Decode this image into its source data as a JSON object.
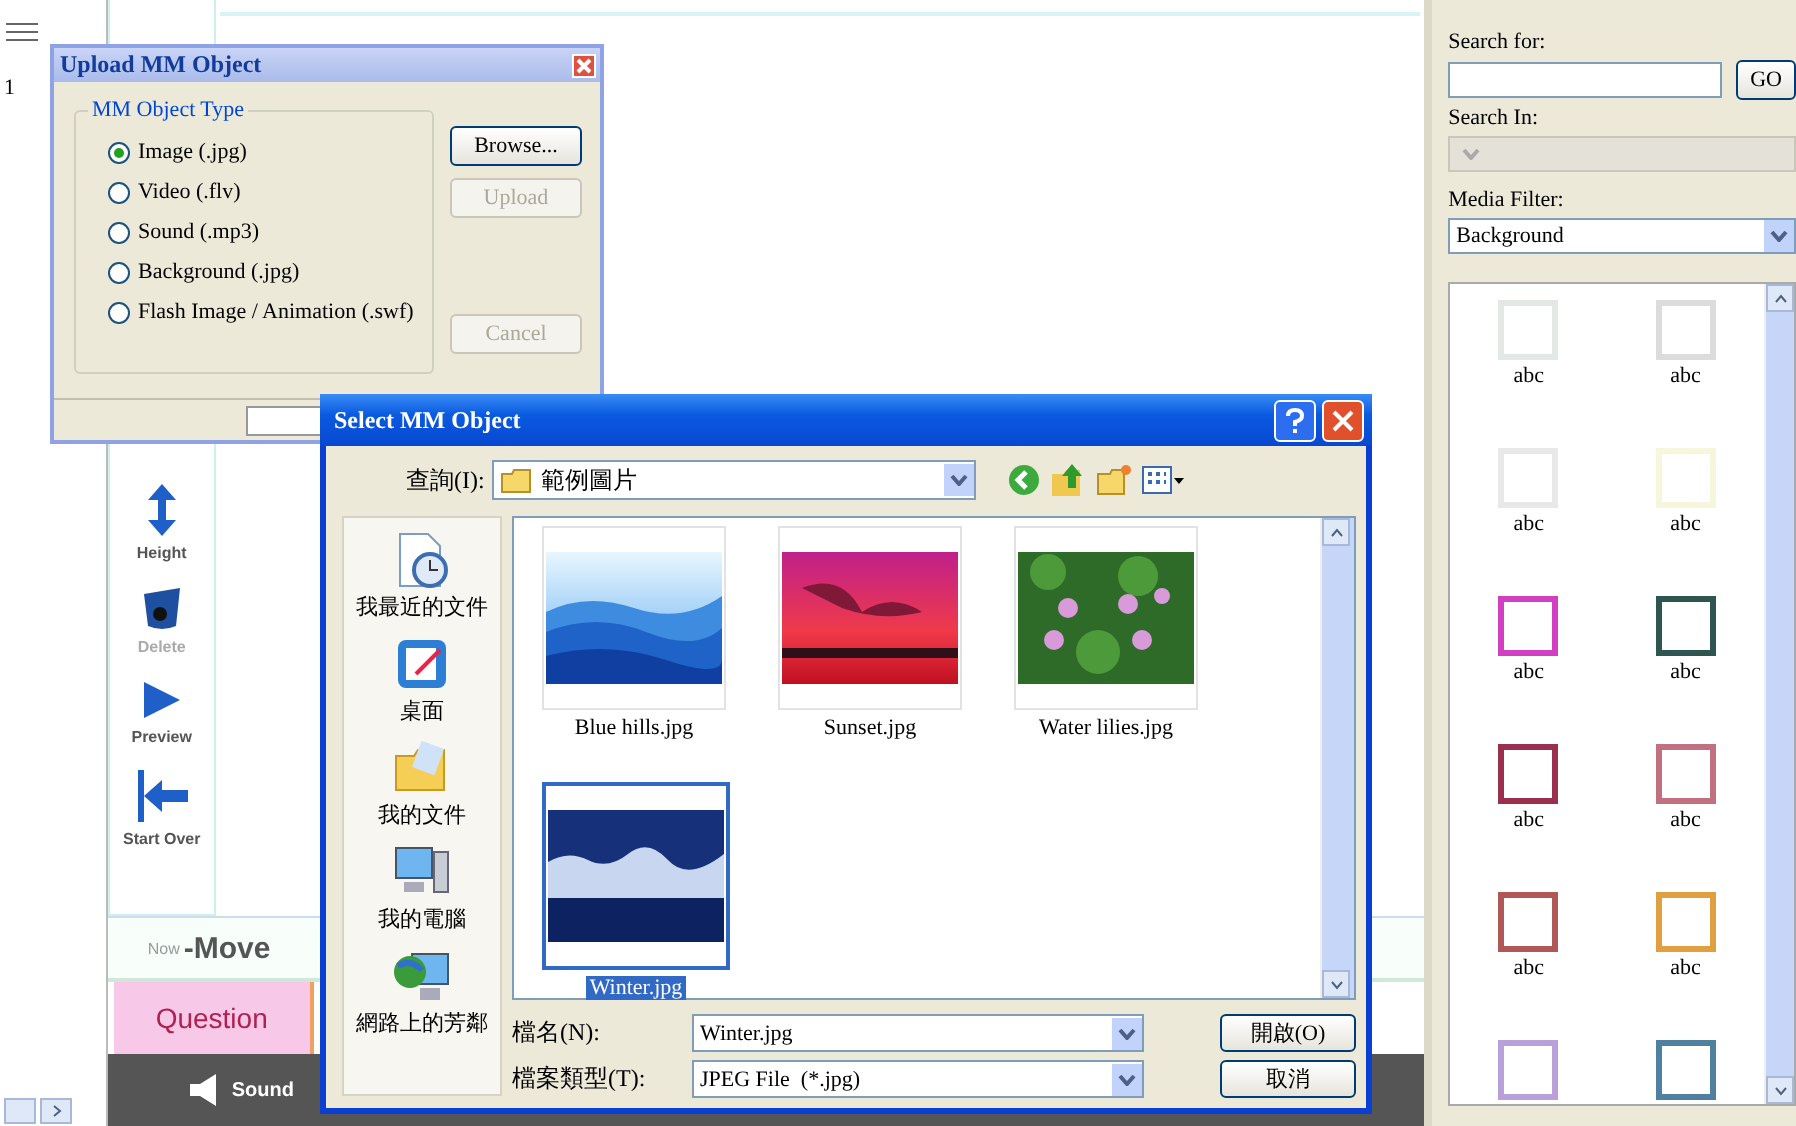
{
  "left_strip": {
    "row_number": "1"
  },
  "toolbar": {
    "tools": [
      {
        "label": "Height",
        "kind": "height",
        "disabled": false
      },
      {
        "label": "Delete",
        "kind": "delete",
        "disabled": true
      },
      {
        "label": "Preview",
        "kind": "preview",
        "disabled": false
      },
      {
        "label": "Start Over",
        "kind": "start_over",
        "disabled": false
      }
    ]
  },
  "mode": {
    "prefix": "Now",
    "value": "-Move"
  },
  "question_button": "Question",
  "media_bar": {
    "items": [
      {
        "label": "Sound",
        "kind": "sound"
      }
    ]
  },
  "right_panel": {
    "search_label": "Search for:",
    "go_button": "GO",
    "search_in_label": "Search In:",
    "search_in": {
      "disabled": true
    },
    "media_filter_label": "Media Filter:",
    "media_filter": "Background",
    "media_items": [
      {
        "label": "abc",
        "color": "#e4e8e4"
      },
      {
        "label": "abc",
        "color": "#dcdcdc"
      },
      {
        "label": "abc",
        "color": "#e8e8e8"
      },
      {
        "label": "abc",
        "color": "#f6f6dc"
      },
      {
        "label": "abc",
        "color": "#d040c0"
      },
      {
        "label": "abc",
        "color": "#2f5550"
      },
      {
        "label": "abc",
        "color": "#9a3050"
      },
      {
        "label": "abc",
        "color": "#c07080"
      },
      {
        "label": "abc",
        "color": "#b05858"
      },
      {
        "label": "abc",
        "color": "#e0a040"
      },
      {
        "color": "#b8a0d8"
      },
      {
        "color": "#5080a0"
      }
    ]
  },
  "upload_dialog": {
    "title": "Upload MM Object",
    "group_label": "MM Object Type",
    "options": [
      {
        "label": "Image (.jpg)",
        "selected": true
      },
      {
        "label": "Video (.flv)",
        "selected": false
      },
      {
        "label": "Sound (.mp3)",
        "selected": false
      },
      {
        "label": "Background (.jpg)",
        "selected": false
      },
      {
        "label": "Flash Image / Animation (.swf)",
        "selected": false
      }
    ],
    "buttons": [
      {
        "label": "Browse...",
        "disabled": false
      },
      {
        "label": "Upload",
        "disabled": true
      },
      {
        "label": "Cancel",
        "disabled": true
      }
    ]
  },
  "file_dialog": {
    "title": "Select MM Object",
    "look_in_label": "查詢(I):",
    "look_in": "範例圖片",
    "places": [
      {
        "label": "我最近的文件",
        "kind": "recent"
      },
      {
        "label": "桌面",
        "kind": "desktop"
      },
      {
        "label": "我的文件",
        "kind": "documents"
      },
      {
        "label": "我的電腦",
        "kind": "computer"
      },
      {
        "label": "網路上的芳鄰",
        "kind": "network"
      }
    ],
    "files": [
      {
        "name": "Blue hills.jpg",
        "kind": "mountains",
        "selected": false
      },
      {
        "name": "Sunset.jpg",
        "kind": "sunset",
        "selected": false
      },
      {
        "name": "Water lilies.jpg",
        "kind": "lilies",
        "selected": false
      },
      {
        "name": "Winter.jpg",
        "kind": "winter",
        "selected": true
      }
    ],
    "file_name_label": "檔名(N):",
    "file_name": "Winter.jpg",
    "file_type_label": "檔案類型(T):",
    "file_type": "JPEG File  (*.jpg)",
    "buttons": [
      "開啟(O)",
      "取消"
    ]
  }
}
